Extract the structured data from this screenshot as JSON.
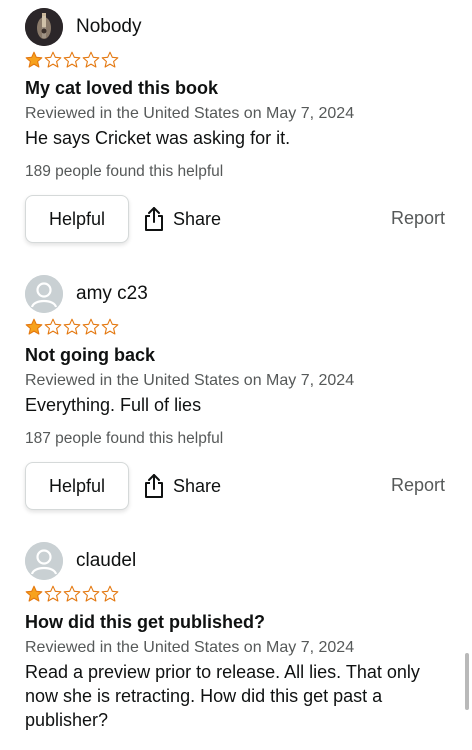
{
  "reviews": [
    {
      "author": "Nobody",
      "avatar": "photo-avatar",
      "rating": 1,
      "max_rating": 5,
      "title": "My cat loved this book",
      "meta": "Reviewed in the United States on May 7, 2024",
      "body": "He says Cricket was asking for it.",
      "helpful_count": "189 people found this helpful",
      "helpful_label": "Helpful",
      "share_label": "Share",
      "report_label": "Report"
    },
    {
      "author": "amy c23",
      "avatar": "default-avatar",
      "rating": 1,
      "max_rating": 5,
      "title": "Not going back",
      "meta": "Reviewed in the United States on May 7, 2024",
      "body": "Everything. Full of lies",
      "helpful_count": "187 people found this helpful",
      "helpful_label": "Helpful",
      "share_label": "Share",
      "report_label": "Report"
    },
    {
      "author": "claudel",
      "avatar": "default-avatar",
      "rating": 1,
      "max_rating": 5,
      "title": "How did this get published?",
      "meta": "Reviewed in the United States on May 7, 2024",
      "body": "Read a preview prior to release. All lies. That only now she is retracting. How did this get past a publisher?"
    }
  ],
  "colors": {
    "star_filled": "#f7a21d",
    "star_outline": "#e47911",
    "text_primary": "#0f1111",
    "text_secondary": "#565959",
    "button_border": "#d5d9d9"
  }
}
